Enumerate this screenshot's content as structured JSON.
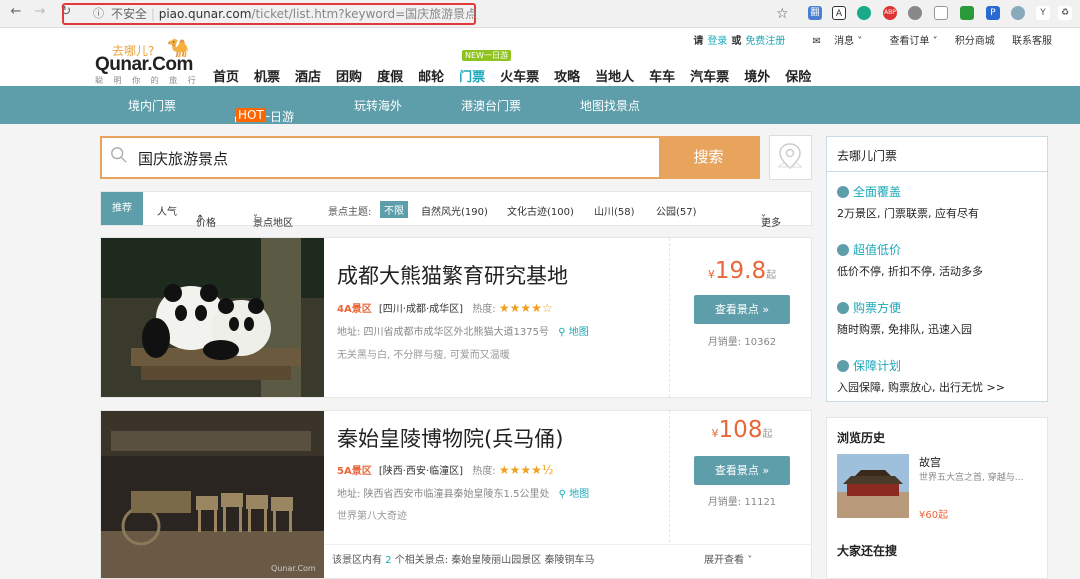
{
  "browser": {
    "insecure_label": "不安全",
    "url_host": "piao.qunar.com",
    "url_path": "/ticket/list.htm?keyword=国庆旅游景点"
  },
  "header": {
    "logo_cn": "去哪儿?",
    "logo_en": "Qunar.Com",
    "logo_slogan": "聪 明 你 的 旅 行",
    "login_prefix": "请",
    "login": "登录",
    "or": "或",
    "register": "免费注册",
    "messages": "消息",
    "orders": "查看订单",
    "points_mall": "积分商城",
    "contact": "联系客服",
    "new_tag": "NEW一日游",
    "nav": [
      "首页",
      "机票",
      "酒店",
      "团购",
      "度假",
      "邮轮",
      "门票",
      "火车票",
      "攻略",
      "当地人",
      "车车",
      "汽车票",
      "境外",
      "保险"
    ],
    "active_nav": "门票"
  },
  "subnav": {
    "items": [
      "境内门票",
      "品质一日游",
      "玩转海外",
      "港澳台门票",
      "地图找景点"
    ],
    "hot_badge": "HOT"
  },
  "search": {
    "query": "国庆旅游景点",
    "button": "搜索"
  },
  "filters": {
    "recommend": "推荐",
    "popularity": "人气",
    "price": "价格",
    "region": "景点地区",
    "theme_label": "景点主题:",
    "unlimited": "不限",
    "theme_nature": "自然风光(190)",
    "theme_culture": "文化古迹(100)",
    "theme_mountain": "山川(58)",
    "theme_park": "公园(57)",
    "more": "更多"
  },
  "results": [
    {
      "title": "成都大熊猫繁育研究基地",
      "level": "4A景区",
      "region": "[四川·成都·成华区]",
      "heat_label": "热度:",
      "stars": "★★★★☆",
      "address": "地址: 四川省成都市成华区外北熊猫大道1375号",
      "map": "地图",
      "desc": "无关黑与白, 不分胖与瘦, 可爱而又温暖",
      "yen": "¥",
      "price": "19.8",
      "qi": "起",
      "view": "查看景点 »",
      "sales": "月销量: 10362"
    },
    {
      "title": "秦始皇陵博物院(兵马俑)",
      "level": "5A景区",
      "region": "[陕西·西安·临潼区]",
      "heat_label": "热度:",
      "stars": "★★★★½",
      "address": "地址: 陕西省西安市临潼县秦始皇陵东1.5公里处",
      "map": "地图",
      "desc": "世界第八大奇迹",
      "yen": "¥",
      "price": "108",
      "qi": "起",
      "view": "查看景点 »",
      "sales": "月销量: 11121",
      "related_prefix": "该景区内有",
      "related_count": "2",
      "related_suffix": "个相关景点: 秦始皇陵丽山园景区  秦陵铜车马",
      "expand": "展开查看"
    }
  ],
  "sidebar": {
    "title": "去哪儿门票",
    "sections": [
      {
        "heading": "全面覆盖",
        "desc": "2万景区, 门票联票, 应有尽有"
      },
      {
        "heading": "超值低价",
        "desc": "低价不停, 折扣不停, 活动多多"
      },
      {
        "heading": "购票方便",
        "desc": "随时购票, 免排队, 迅速入园"
      },
      {
        "heading": "保障计划",
        "desc": "入园保障, 购票放心, 出行无忧 >>"
      }
    ],
    "history_title": "浏览历史",
    "history_item": {
      "name": "故宫",
      "desc": "世界五大宫之首, 穿越与…",
      "price": "¥60起"
    },
    "others_title": "大家还在搜"
  },
  "colors": {
    "accent": "#5e9eab",
    "search": "#e8a45d",
    "price": "#e8663a",
    "link": "#1ba9ba"
  }
}
